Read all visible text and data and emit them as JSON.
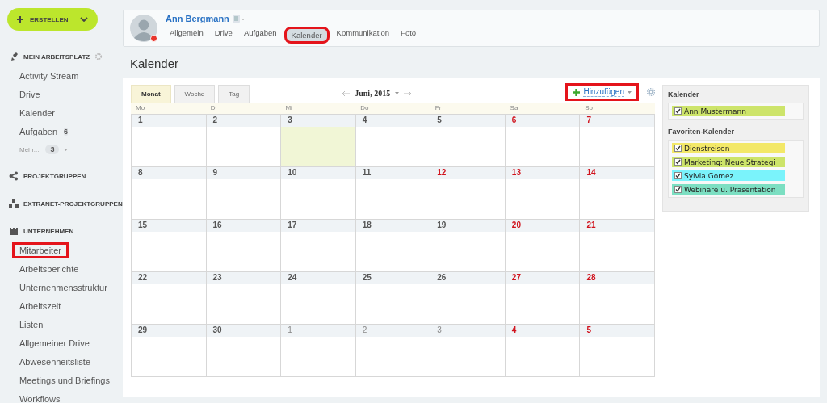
{
  "sidebar": {
    "create_button": {
      "label": "ERSTELLEN"
    },
    "sections": [
      {
        "title": "MEIN ARBEITSPLATZ",
        "items": [
          {
            "label": "Activity Stream",
            "highlighted": false
          },
          {
            "label": "Drive",
            "highlighted": false
          },
          {
            "label": "Kalender",
            "highlighted": false
          },
          {
            "label": "Aufgaben",
            "counter": "6",
            "highlighted": false
          }
        ],
        "more": {
          "label": "Mehr...",
          "counter": "3"
        }
      },
      {
        "title": "PROJEKTGRUPPEN"
      },
      {
        "title": "EXTRANET-PROJEKTGRUPPEN"
      },
      {
        "title": "UNTERNEHMEN",
        "items": [
          {
            "label": "Mitarbeiter",
            "highlighted": true
          },
          {
            "label": "Arbeitsberichte",
            "highlighted": false
          },
          {
            "label": "Unternehmensstruktur",
            "highlighted": false
          },
          {
            "label": "Arbeitszeit",
            "highlighted": false
          },
          {
            "label": "Listen",
            "highlighted": false
          },
          {
            "label": "Allgemeiner Drive",
            "highlighted": false
          },
          {
            "label": "Abwesenheitsliste",
            "highlighted": false
          },
          {
            "label": "Meetings und Briefings",
            "highlighted": false
          },
          {
            "label": "Workflows",
            "highlighted": false
          }
        ]
      }
    ]
  },
  "profile": {
    "name": "Ann Bergmann",
    "tabs": [
      {
        "label": "Allgemein",
        "selected": false,
        "highlighted": false
      },
      {
        "label": "Drive",
        "selected": false,
        "highlighted": false
      },
      {
        "label": "Aufgaben",
        "selected": false,
        "highlighted": false
      },
      {
        "label": "Kalender",
        "selected": true,
        "highlighted": true
      },
      {
        "label": "Kommunikation",
        "selected": false,
        "highlighted": false
      },
      {
        "label": "Foto",
        "selected": false,
        "highlighted": false
      }
    ]
  },
  "page_title": "Kalender",
  "calendar": {
    "view_tabs": [
      {
        "label": "Monat",
        "selected": true
      },
      {
        "label": "Woche",
        "selected": false
      },
      {
        "label": "Tag",
        "selected": false
      }
    ],
    "month": "Juni, 2015",
    "add_button": {
      "label": "Hinzufügen",
      "highlighted": true
    },
    "weekdays": [
      "Mo",
      "Di",
      "Mi",
      "Do",
      "Fr",
      "Sa",
      "So"
    ],
    "weeks": [
      [
        {
          "day": "1",
          "holiday": false,
          "other_month": false,
          "today": false
        },
        {
          "day": "2",
          "holiday": false,
          "other_month": false,
          "today": false
        },
        {
          "day": "3",
          "holiday": false,
          "other_month": false,
          "today": true
        },
        {
          "day": "4",
          "holiday": false,
          "other_month": false,
          "today": false
        },
        {
          "day": "5",
          "holiday": false,
          "other_month": false,
          "today": false
        },
        {
          "day": "6",
          "holiday": true,
          "other_month": false,
          "today": false
        },
        {
          "day": "7",
          "holiday": true,
          "other_month": false,
          "today": false
        }
      ],
      [
        {
          "day": "8",
          "holiday": false,
          "other_month": false,
          "today": false
        },
        {
          "day": "9",
          "holiday": false,
          "other_month": false,
          "today": false
        },
        {
          "day": "10",
          "holiday": false,
          "other_month": false,
          "today": false
        },
        {
          "day": "11",
          "holiday": false,
          "other_month": false,
          "today": false
        },
        {
          "day": "12",
          "holiday": true,
          "other_month": false,
          "today": false
        },
        {
          "day": "13",
          "holiday": true,
          "other_month": false,
          "today": false
        },
        {
          "day": "14",
          "holiday": true,
          "other_month": false,
          "today": false
        }
      ],
      [
        {
          "day": "15",
          "holiday": false,
          "other_month": false,
          "today": false
        },
        {
          "day": "16",
          "holiday": false,
          "other_month": false,
          "today": false
        },
        {
          "day": "17",
          "holiday": false,
          "other_month": false,
          "today": false
        },
        {
          "day": "18",
          "holiday": false,
          "other_month": false,
          "today": false
        },
        {
          "day": "19",
          "holiday": false,
          "other_month": false,
          "today": false
        },
        {
          "day": "20",
          "holiday": true,
          "other_month": false,
          "today": false
        },
        {
          "day": "21",
          "holiday": true,
          "other_month": false,
          "today": false
        }
      ],
      [
        {
          "day": "22",
          "holiday": false,
          "other_month": false,
          "today": false
        },
        {
          "day": "23",
          "holiday": false,
          "other_month": false,
          "today": false
        },
        {
          "day": "24",
          "holiday": false,
          "other_month": false,
          "today": false
        },
        {
          "day": "25",
          "holiday": false,
          "other_month": false,
          "today": false
        },
        {
          "day": "26",
          "holiday": false,
          "other_month": false,
          "today": false
        },
        {
          "day": "27",
          "holiday": true,
          "other_month": false,
          "today": false
        },
        {
          "day": "28",
          "holiday": true,
          "other_month": false,
          "today": false
        }
      ],
      [
        {
          "day": "29",
          "holiday": false,
          "other_month": false,
          "today": false
        },
        {
          "day": "30",
          "holiday": false,
          "other_month": false,
          "today": false
        },
        {
          "day": "1",
          "holiday": false,
          "other_month": true,
          "today": false
        },
        {
          "day": "2",
          "holiday": false,
          "other_month": true,
          "today": false
        },
        {
          "day": "3",
          "holiday": false,
          "other_month": true,
          "today": false
        },
        {
          "day": "4",
          "holiday": true,
          "other_month": true,
          "today": false
        },
        {
          "day": "5",
          "holiday": true,
          "other_month": true,
          "today": false
        }
      ]
    ]
  },
  "calendar_list": {
    "groups": [
      {
        "title": "Kalender",
        "entries": [
          {
            "label": "Ann Mustermann",
            "checked": true,
            "color": "#cde46a"
          }
        ]
      },
      {
        "title": "Favoriten-Kalender",
        "entries": [
          {
            "label": "Dienstreisen",
            "checked": true,
            "color": "#f3e868"
          },
          {
            "label": "Marketing: Neue Strategi",
            "checked": true,
            "color": "#cde46a"
          },
          {
            "label": "Sylvia Gomez",
            "checked": true,
            "color": "#7af3fb"
          },
          {
            "label": "Webinare u. Präsentation",
            "checked": true,
            "color": "#7cdfc2"
          }
        ]
      }
    ]
  }
}
